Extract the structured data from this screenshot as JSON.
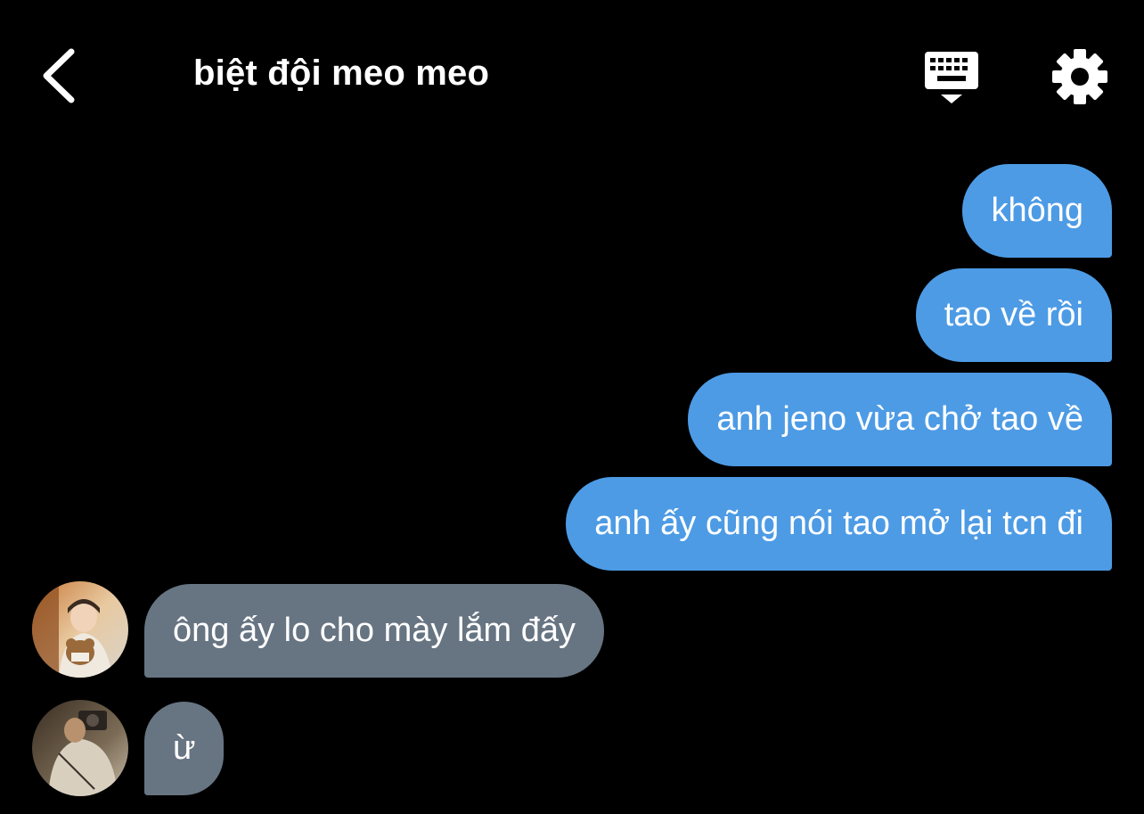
{
  "header": {
    "title": "biệt đội meo meo",
    "back_icon": "chevron-left-icon",
    "keyboard_icon": "keyboard-icon",
    "settings_icon": "gear-icon"
  },
  "colors": {
    "background": "#000000",
    "outgoing_bubble": "#4d9be5",
    "incoming_bubble": "#677482",
    "text": "#ffffff"
  },
  "messages": [
    {
      "direction": "outgoing",
      "text": "không"
    },
    {
      "direction": "outgoing",
      "text": "tao về rồi"
    },
    {
      "direction": "outgoing",
      "text": "anh jeno vừa chở tao về"
    },
    {
      "direction": "outgoing",
      "text": "anh ấy cũng nói tao mở lại tcn đi"
    },
    {
      "direction": "incoming",
      "text": "ông ấy lo cho mày lắm đấy"
    },
    {
      "direction": "incoming",
      "text": "ừ"
    }
  ]
}
